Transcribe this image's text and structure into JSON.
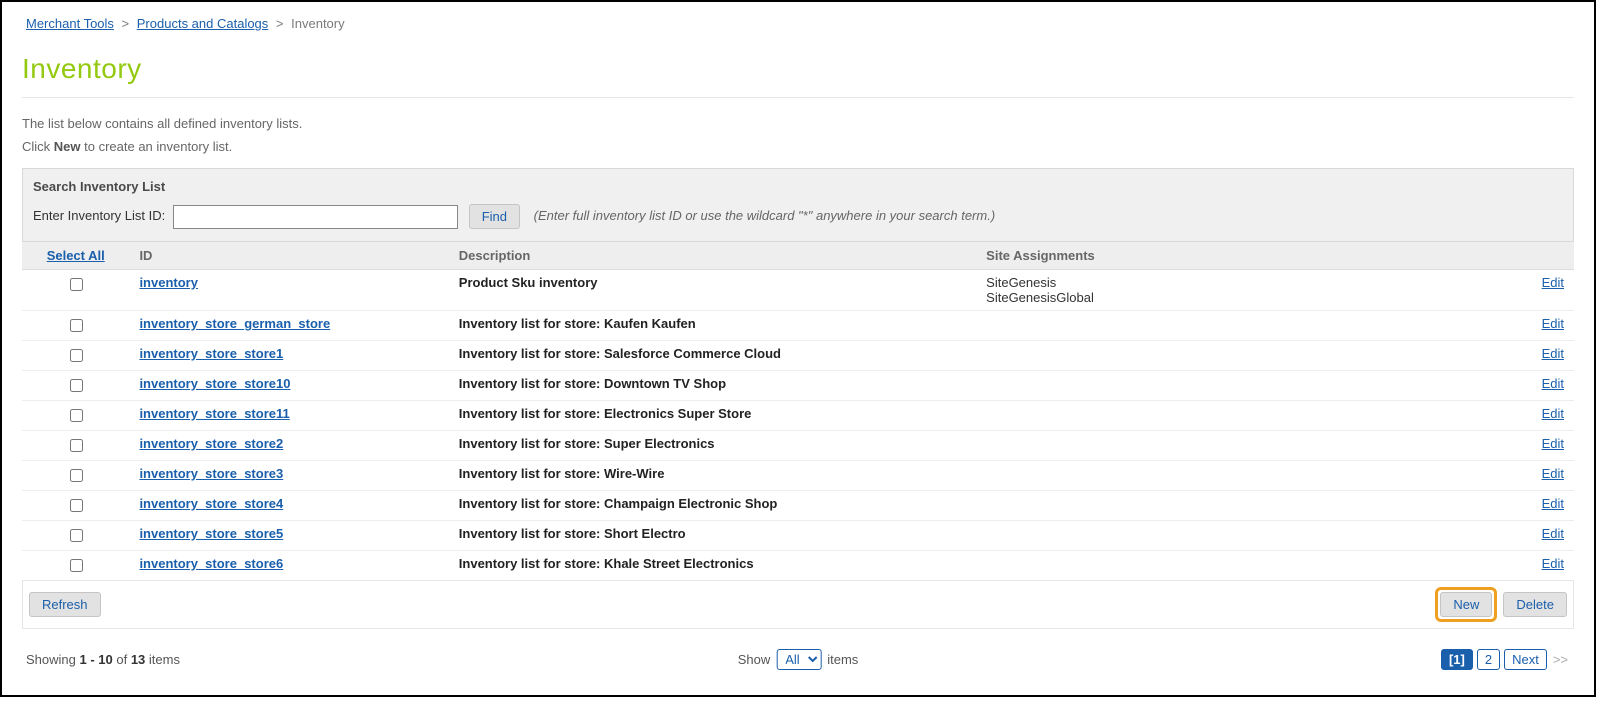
{
  "breadcrumbs": {
    "item1": "Merchant Tools",
    "item2": "Products and Catalogs",
    "current": "Inventory"
  },
  "title": "Inventory",
  "intro": {
    "line1": "The list below contains all defined inventory lists.",
    "line2_pre": "Click ",
    "line2_bold": "New",
    "line2_post": " to create an inventory list."
  },
  "search": {
    "title": "Search Inventory List",
    "label": "Enter Inventory List ID:",
    "find_btn": "Find",
    "hint": "(Enter full inventory list ID or use the wildcard \"*\" anywhere in your search term.)"
  },
  "table": {
    "headers": {
      "select_all": "Select All",
      "id": "ID",
      "description": "Description",
      "site": "Site Assignments"
    },
    "edit_label": "Edit",
    "rows": [
      {
        "id": "inventory",
        "description": "Product Sku inventory",
        "site": "SiteGenesis\nSiteGenesisGlobal"
      },
      {
        "id": "inventory_store_german_store",
        "description": "Inventory list for store: Kaufen Kaufen",
        "site": ""
      },
      {
        "id": "inventory_store_store1",
        "description": "Inventory list for store: Salesforce Commerce Cloud",
        "site": ""
      },
      {
        "id": "inventory_store_store10",
        "description": "Inventory list for store: Downtown TV Shop",
        "site": ""
      },
      {
        "id": "inventory_store_store11",
        "description": "Inventory list for store: Electronics Super Store",
        "site": ""
      },
      {
        "id": "inventory_store_store2",
        "description": "Inventory list for store: Super Electronics",
        "site": ""
      },
      {
        "id": "inventory_store_store3",
        "description": "Inventory list for store: Wire-Wire",
        "site": ""
      },
      {
        "id": "inventory_store_store4",
        "description": "Inventory list for store: Champaign Electronic Shop",
        "site": ""
      },
      {
        "id": "inventory_store_store5",
        "description": "Inventory list for store: Short Electro",
        "site": ""
      },
      {
        "id": "inventory_store_store6",
        "description": "Inventory list for store: Khale Street Electronics",
        "site": ""
      }
    ]
  },
  "actions": {
    "refresh": "Refresh",
    "new": "New",
    "delete": "Delete"
  },
  "pager": {
    "showing_pre": "Showing ",
    "range": "1 - 10",
    "of": " of ",
    "total": "13",
    "items_suffix": " items",
    "show_label": "Show",
    "show_value": "All",
    "items_label": "items",
    "page1": "[1]",
    "page2": "2",
    "next": "Next",
    "arrow": ">>"
  }
}
